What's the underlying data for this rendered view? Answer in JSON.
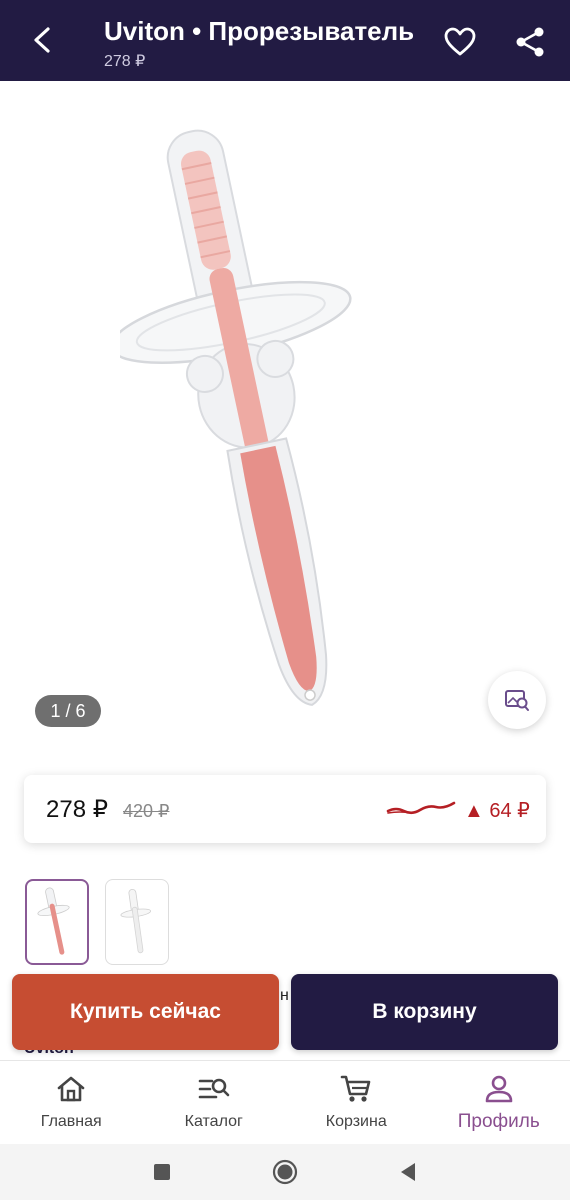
{
  "header": {
    "title": "Uviton • Прорезыватель",
    "subtitle": "278 ₽"
  },
  "gallery": {
    "counter": "1 / 6",
    "image_colors": {
      "handle": "#e39a94",
      "silicone": "#eef0f2"
    }
  },
  "price": {
    "current": "278 ₽",
    "old": "420 ₽",
    "change": "▲ 64 ₽",
    "change_color": "#b51f24"
  },
  "thumbnails": [
    {
      "name": "thumb-1",
      "active": true
    },
    {
      "name": "thumb-2",
      "active": false
    }
  ],
  "peek": {
    "text_fragment": "н",
    "brand": "Uviton"
  },
  "actions": {
    "buy_now": "Купить сейчас",
    "add_to_cart": "В корзину"
  },
  "nav": {
    "items": [
      {
        "label": "Главная",
        "icon": "home-icon"
      },
      {
        "label": "Каталог",
        "icon": "catalog-search-icon"
      },
      {
        "label": "Корзина",
        "icon": "cart-icon"
      },
      {
        "label": "Профиль",
        "icon": "profile-icon"
      }
    ]
  },
  "colors": {
    "header_bg": "#221b43",
    "buy_now_bg": "#c64d32",
    "accent": "#8a4f8f"
  }
}
